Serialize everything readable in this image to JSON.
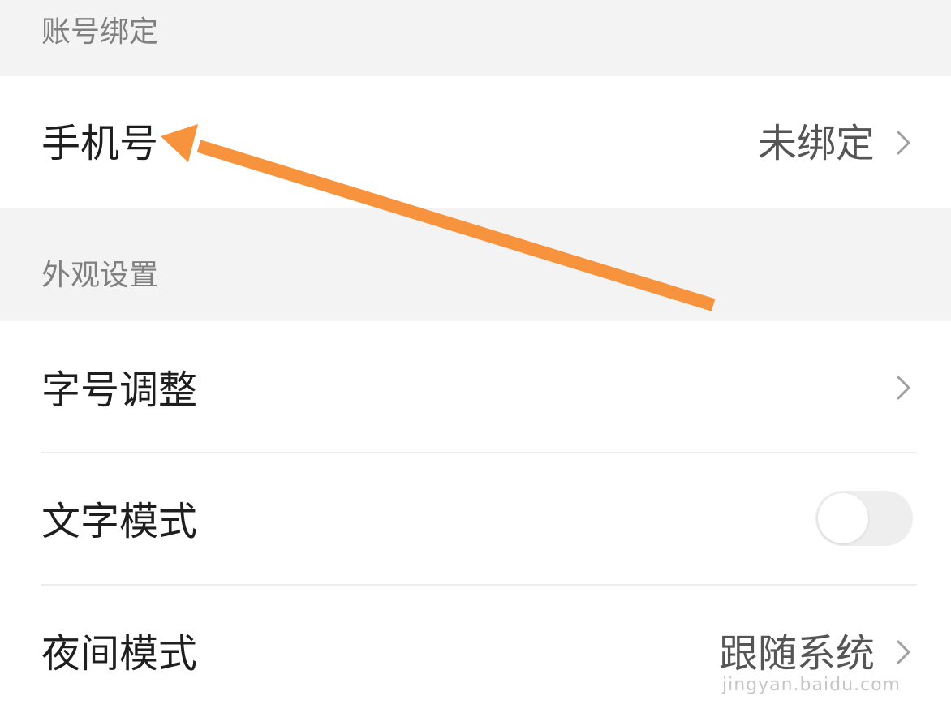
{
  "sections": {
    "account": {
      "title": "账号绑定"
    },
    "appearance": {
      "title": "外观设置"
    }
  },
  "rows": {
    "phone": {
      "label": "手机号",
      "value": "未绑定",
      "chevron_icon": "chevron-right-icon"
    },
    "font_size": {
      "label": "字号调整",
      "chevron_icon": "chevron-right-icon"
    },
    "text_mode": {
      "label": "文字模式",
      "toggle_on": false
    },
    "night_mode": {
      "label": "夜间模式",
      "value": "跟随系统",
      "chevron_icon": "chevron-right-icon"
    }
  },
  "annotation": {
    "icon": "arrow-icon",
    "color": "#f7923d"
  },
  "watermark": {
    "text": "jingyan.baidu.com"
  },
  "colors": {
    "section_bg": "#f3f3f3",
    "row_bg": "#ffffff",
    "label": "#1e1e1e",
    "section_title": "#808080",
    "value": "#555555",
    "toggle_off": "#eeeeee"
  }
}
